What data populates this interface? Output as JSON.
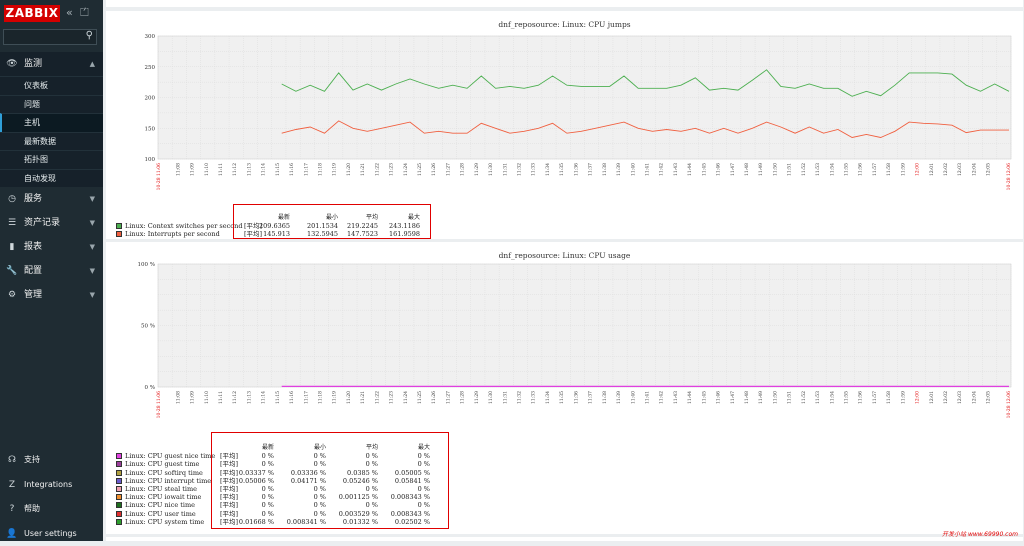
{
  "sidebar": {
    "logo": "ZABBIX",
    "collapse_icon": "«",
    "kiosk_icon": "⏍",
    "menu": [
      {
        "label": "监测",
        "icon": "eye-icon",
        "glyph": "👁",
        "open": true,
        "children": [
          {
            "label": "仪表板"
          },
          {
            "label": "问题"
          },
          {
            "label": "主机",
            "active": true
          },
          {
            "label": "最新数据"
          },
          {
            "label": "拓扑图"
          },
          {
            "label": "自动发现"
          }
        ]
      },
      {
        "label": "服务",
        "icon": "clock-icon",
        "glyph": "◷"
      },
      {
        "label": "资产记录",
        "icon": "list-icon",
        "glyph": "☰"
      },
      {
        "label": "报表",
        "icon": "chart-icon",
        "glyph": "▮"
      },
      {
        "label": "配置",
        "icon": "wrench-icon",
        "glyph": "🔧"
      },
      {
        "label": "管理",
        "icon": "gear-icon",
        "glyph": "⚙"
      }
    ],
    "bottom": [
      {
        "label": "支持",
        "icon": "headset-icon",
        "glyph": "☊"
      },
      {
        "label": "Integrations",
        "icon": "integrations-icon",
        "glyph": "Z"
      },
      {
        "label": "帮助",
        "icon": "help-icon",
        "glyph": "?"
      },
      {
        "label": "User settings",
        "icon": "user-icon",
        "glyph": "👤"
      }
    ]
  },
  "headers": {
    "latest": "最新",
    "min": "最小",
    "avg": "平均",
    "max": "最大",
    "agg": "[平均]"
  },
  "graph1": {
    "title": "dnf_reposource: Linux: CPU jumps",
    "y_ticks": [
      "300",
      "250",
      "200",
      "150",
      "100"
    ],
    "ylim": [
      100,
      300
    ],
    "x_start": "10-28 11:06",
    "x_ticks": [
      "11:08",
      "11:09",
      "11:10",
      "11:11",
      "11:12",
      "11:13",
      "11:14",
      "11:15",
      "11:16",
      "11:17",
      "11:18",
      "11:19",
      "11:20",
      "11:21",
      "11:22",
      "11:23",
      "11:24",
      "11:25",
      "11:26",
      "11:27",
      "11:28",
      "11:29",
      "11:30",
      "11:31",
      "11:32",
      "11:33",
      "11:34",
      "11:35",
      "11:36",
      "11:37",
      "11:38",
      "11:39",
      "11:40",
      "11:41",
      "11:42",
      "11:43",
      "11:44",
      "11:45",
      "11:46",
      "11:47",
      "11:48",
      "11:49",
      "11:50",
      "11:51",
      "11:52",
      "11:53",
      "11:54",
      "11:55",
      "11:56",
      "11:57",
      "11:58",
      "11:59",
      "12:00",
      "12:01",
      "12:02",
      "12:03",
      "12:04",
      "12:05"
    ],
    "x_end": "10-28 12:06",
    "colors": {
      "green": "#4caf50",
      "red": "#f06040"
    },
    "series": [
      {
        "name": "Linux: Context switches per second",
        "color": "#4caf50",
        "latest": "209.6365",
        "min": "201.1534",
        "avg": "219.2245",
        "max": "243.1186",
        "values": [
          222,
          210,
          220,
          210,
          240,
          212,
          222,
          212,
          222,
          230,
          222,
          215,
          220,
          215,
          235,
          215,
          218,
          215,
          220,
          235,
          220,
          218,
          218,
          218,
          235,
          215,
          215,
          215,
          220,
          232,
          212,
          215,
          212,
          228,
          245,
          218,
          215,
          222,
          215,
          215,
          202,
          210,
          203,
          220,
          240,
          240,
          240,
          238,
          220,
          210,
          222,
          210
        ]
      },
      {
        "name": "Linux: Interrupts per second",
        "color": "#f06040",
        "latest": "145.913",
        "min": "132.5945",
        "avg": "147.7523",
        "max": "161.9598",
        "values": [
          142,
          148,
          152,
          142,
          162,
          150,
          145,
          150,
          155,
          160,
          142,
          145,
          142,
          142,
          158,
          150,
          142,
          145,
          150,
          158,
          142,
          145,
          150,
          155,
          160,
          150,
          145,
          148,
          145,
          150,
          142,
          150,
          142,
          150,
          160,
          152,
          142,
          152,
          142,
          148,
          135,
          140,
          135,
          145,
          160,
          158,
          157,
          155,
          143,
          147,
          147,
          147
        ]
      }
    ]
  },
  "graph2": {
    "title": "dnf_reposource: Linux: CPU usage",
    "y_ticks": [
      "100 %",
      "50 %",
      "0 %"
    ],
    "ylim": [
      0,
      100
    ],
    "x_start": "10-28 11:06",
    "x_end": "10-28 12:06",
    "series": [
      {
        "name": "Linux: CPU guest nice time",
        "color": "#e040e0",
        "latest": "0 %",
        "min": "0 %",
        "avg": "0 %",
        "max": "0 %"
      },
      {
        "name": "Linux: CPU guest time",
        "color": "#9c3f9c",
        "latest": "0 %",
        "min": "0 %",
        "avg": "0 %",
        "max": "0 %"
      },
      {
        "name": "Linux: CPU softirq time",
        "color": "#b0a040",
        "latest": "0.03337 %",
        "min": "0.03336 %",
        "avg": "0.0385 %",
        "max": "0.05005 %"
      },
      {
        "name": "Linux: CPU interrupt time",
        "color": "#6a5acd",
        "latest": "0.05006 %",
        "min": "0.04171 %",
        "avg": "0.05246 %",
        "max": "0.05841 %"
      },
      {
        "name": "Linux: CPU steal time",
        "color": "#f0a0b0",
        "latest": "0 %",
        "min": "0 %",
        "avg": "0 %",
        "max": "0 %"
      },
      {
        "name": "Linux: CPU iowait time",
        "color": "#f09030",
        "latest": "0 %",
        "min": "0 %",
        "avg": "0.001125 %",
        "max": "0.008343 %"
      },
      {
        "name": "Linux: CPU nice time",
        "color": "#1f6f1f",
        "latest": "0 %",
        "min": "0 %",
        "avg": "0 %",
        "max": "0 %"
      },
      {
        "name": "Linux: CPU user time",
        "color": "#e03030",
        "latest": "0 %",
        "min": "0 %",
        "avg": "0.003529 %",
        "max": "0.008343 %"
      },
      {
        "name": "Linux: CPU system time",
        "color": "#2e9e2e",
        "latest": "0.01668 %",
        "min": "0.008341 %",
        "avg": "0.01332 %",
        "max": "0.02502 %"
      }
    ]
  },
  "watermark": "开发小站 www.69990.com"
}
